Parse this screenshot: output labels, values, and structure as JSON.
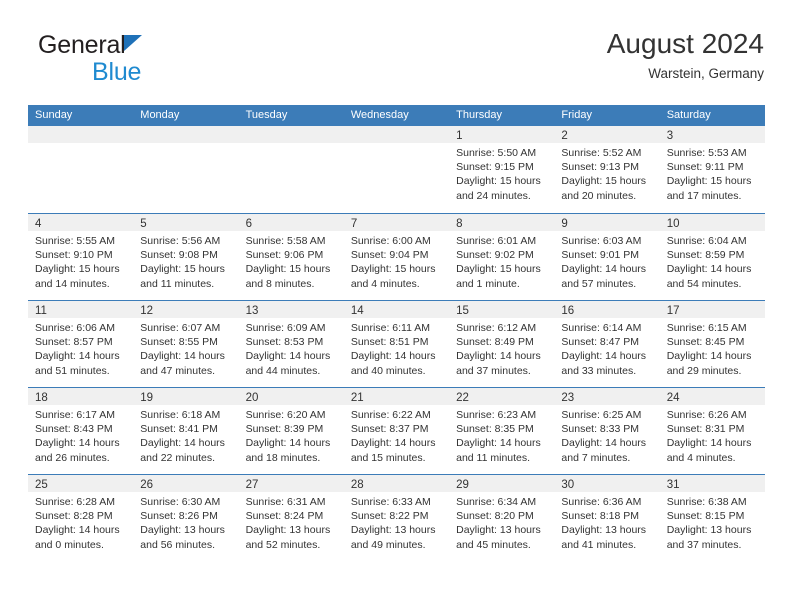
{
  "brand": {
    "name_part1": "General",
    "name_part2": "Blue",
    "triangle_color": "#1f71b8",
    "blue_text_color": "#1f8ad0"
  },
  "header": {
    "title": "August 2024",
    "subtitle": "Warstein, Germany"
  },
  "theme": {
    "header_blue": "#3c7cb8",
    "day_band_gray": "#f0f0f0",
    "text_color": "#333333"
  },
  "weekdays": [
    "Sunday",
    "Monday",
    "Tuesday",
    "Wednesday",
    "Thursday",
    "Friday",
    "Saturday"
  ],
  "weeks": [
    [
      {
        "day": "",
        "sunrise": "",
        "sunset": "",
        "daylight1": "",
        "daylight2": ""
      },
      {
        "day": "",
        "sunrise": "",
        "sunset": "",
        "daylight1": "",
        "daylight2": ""
      },
      {
        "day": "",
        "sunrise": "",
        "sunset": "",
        "daylight1": "",
        "daylight2": ""
      },
      {
        "day": "",
        "sunrise": "",
        "sunset": "",
        "daylight1": "",
        "daylight2": ""
      },
      {
        "day": "1",
        "sunrise": "Sunrise: 5:50 AM",
        "sunset": "Sunset: 9:15 PM",
        "daylight1": "Daylight: 15 hours",
        "daylight2": "and 24 minutes."
      },
      {
        "day": "2",
        "sunrise": "Sunrise: 5:52 AM",
        "sunset": "Sunset: 9:13 PM",
        "daylight1": "Daylight: 15 hours",
        "daylight2": "and 20 minutes."
      },
      {
        "day": "3",
        "sunrise": "Sunrise: 5:53 AM",
        "sunset": "Sunset: 9:11 PM",
        "daylight1": "Daylight: 15 hours",
        "daylight2": "and 17 minutes."
      }
    ],
    [
      {
        "day": "4",
        "sunrise": "Sunrise: 5:55 AM",
        "sunset": "Sunset: 9:10 PM",
        "daylight1": "Daylight: 15 hours",
        "daylight2": "and 14 minutes."
      },
      {
        "day": "5",
        "sunrise": "Sunrise: 5:56 AM",
        "sunset": "Sunset: 9:08 PM",
        "daylight1": "Daylight: 15 hours",
        "daylight2": "and 11 minutes."
      },
      {
        "day": "6",
        "sunrise": "Sunrise: 5:58 AM",
        "sunset": "Sunset: 9:06 PM",
        "daylight1": "Daylight: 15 hours",
        "daylight2": "and 8 minutes."
      },
      {
        "day": "7",
        "sunrise": "Sunrise: 6:00 AM",
        "sunset": "Sunset: 9:04 PM",
        "daylight1": "Daylight: 15 hours",
        "daylight2": "and 4 minutes."
      },
      {
        "day": "8",
        "sunrise": "Sunrise: 6:01 AM",
        "sunset": "Sunset: 9:02 PM",
        "daylight1": "Daylight: 15 hours",
        "daylight2": "and 1 minute."
      },
      {
        "day": "9",
        "sunrise": "Sunrise: 6:03 AM",
        "sunset": "Sunset: 9:01 PM",
        "daylight1": "Daylight: 14 hours",
        "daylight2": "and 57 minutes."
      },
      {
        "day": "10",
        "sunrise": "Sunrise: 6:04 AM",
        "sunset": "Sunset: 8:59 PM",
        "daylight1": "Daylight: 14 hours",
        "daylight2": "and 54 minutes."
      }
    ],
    [
      {
        "day": "11",
        "sunrise": "Sunrise: 6:06 AM",
        "sunset": "Sunset: 8:57 PM",
        "daylight1": "Daylight: 14 hours",
        "daylight2": "and 51 minutes."
      },
      {
        "day": "12",
        "sunrise": "Sunrise: 6:07 AM",
        "sunset": "Sunset: 8:55 PM",
        "daylight1": "Daylight: 14 hours",
        "daylight2": "and 47 minutes."
      },
      {
        "day": "13",
        "sunrise": "Sunrise: 6:09 AM",
        "sunset": "Sunset: 8:53 PM",
        "daylight1": "Daylight: 14 hours",
        "daylight2": "and 44 minutes."
      },
      {
        "day": "14",
        "sunrise": "Sunrise: 6:11 AM",
        "sunset": "Sunset: 8:51 PM",
        "daylight1": "Daylight: 14 hours",
        "daylight2": "and 40 minutes."
      },
      {
        "day": "15",
        "sunrise": "Sunrise: 6:12 AM",
        "sunset": "Sunset: 8:49 PM",
        "daylight1": "Daylight: 14 hours",
        "daylight2": "and 37 minutes."
      },
      {
        "day": "16",
        "sunrise": "Sunrise: 6:14 AM",
        "sunset": "Sunset: 8:47 PM",
        "daylight1": "Daylight: 14 hours",
        "daylight2": "and 33 minutes."
      },
      {
        "day": "17",
        "sunrise": "Sunrise: 6:15 AM",
        "sunset": "Sunset: 8:45 PM",
        "daylight1": "Daylight: 14 hours",
        "daylight2": "and 29 minutes."
      }
    ],
    [
      {
        "day": "18",
        "sunrise": "Sunrise: 6:17 AM",
        "sunset": "Sunset: 8:43 PM",
        "daylight1": "Daylight: 14 hours",
        "daylight2": "and 26 minutes."
      },
      {
        "day": "19",
        "sunrise": "Sunrise: 6:18 AM",
        "sunset": "Sunset: 8:41 PM",
        "daylight1": "Daylight: 14 hours",
        "daylight2": "and 22 minutes."
      },
      {
        "day": "20",
        "sunrise": "Sunrise: 6:20 AM",
        "sunset": "Sunset: 8:39 PM",
        "daylight1": "Daylight: 14 hours",
        "daylight2": "and 18 minutes."
      },
      {
        "day": "21",
        "sunrise": "Sunrise: 6:22 AM",
        "sunset": "Sunset: 8:37 PM",
        "daylight1": "Daylight: 14 hours",
        "daylight2": "and 15 minutes."
      },
      {
        "day": "22",
        "sunrise": "Sunrise: 6:23 AM",
        "sunset": "Sunset: 8:35 PM",
        "daylight1": "Daylight: 14 hours",
        "daylight2": "and 11 minutes."
      },
      {
        "day": "23",
        "sunrise": "Sunrise: 6:25 AM",
        "sunset": "Sunset: 8:33 PM",
        "daylight1": "Daylight: 14 hours",
        "daylight2": "and 7 minutes."
      },
      {
        "day": "24",
        "sunrise": "Sunrise: 6:26 AM",
        "sunset": "Sunset: 8:31 PM",
        "daylight1": "Daylight: 14 hours",
        "daylight2": "and 4 minutes."
      }
    ],
    [
      {
        "day": "25",
        "sunrise": "Sunrise: 6:28 AM",
        "sunset": "Sunset: 8:28 PM",
        "daylight1": "Daylight: 14 hours",
        "daylight2": "and 0 minutes."
      },
      {
        "day": "26",
        "sunrise": "Sunrise: 6:30 AM",
        "sunset": "Sunset: 8:26 PM",
        "daylight1": "Daylight: 13 hours",
        "daylight2": "and 56 minutes."
      },
      {
        "day": "27",
        "sunrise": "Sunrise: 6:31 AM",
        "sunset": "Sunset: 8:24 PM",
        "daylight1": "Daylight: 13 hours",
        "daylight2": "and 52 minutes."
      },
      {
        "day": "28",
        "sunrise": "Sunrise: 6:33 AM",
        "sunset": "Sunset: 8:22 PM",
        "daylight1": "Daylight: 13 hours",
        "daylight2": "and 49 minutes."
      },
      {
        "day": "29",
        "sunrise": "Sunrise: 6:34 AM",
        "sunset": "Sunset: 8:20 PM",
        "daylight1": "Daylight: 13 hours",
        "daylight2": "and 45 minutes."
      },
      {
        "day": "30",
        "sunrise": "Sunrise: 6:36 AM",
        "sunset": "Sunset: 8:18 PM",
        "daylight1": "Daylight: 13 hours",
        "daylight2": "and 41 minutes."
      },
      {
        "day": "31",
        "sunrise": "Sunrise: 6:38 AM",
        "sunset": "Sunset: 8:15 PM",
        "daylight1": "Daylight: 13 hours",
        "daylight2": "and 37 minutes."
      }
    ]
  ]
}
